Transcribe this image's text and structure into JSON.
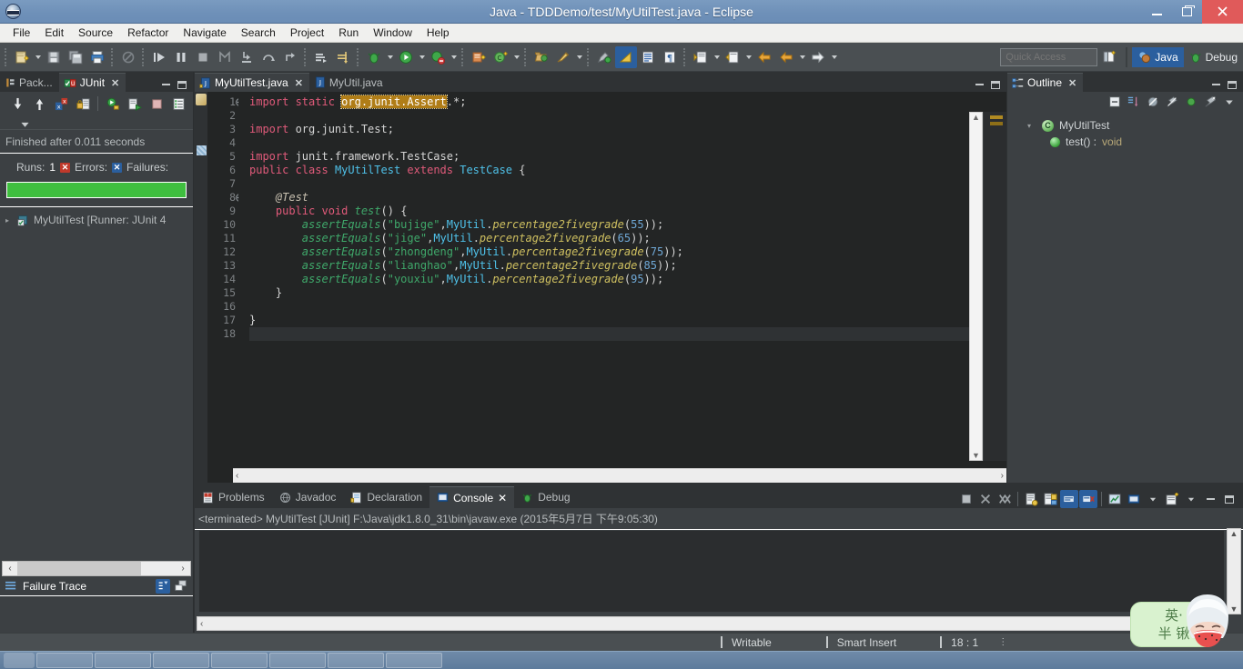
{
  "window": {
    "title": "Java - TDDDemo/test/MyUtilTest.java - Eclipse",
    "minimize_label": "–",
    "maximize_label": "❐",
    "close_label": "✕"
  },
  "menubar": {
    "items": [
      {
        "label": "File"
      },
      {
        "label": "Edit"
      },
      {
        "label": "Source"
      },
      {
        "label": "Refactor"
      },
      {
        "label": "Navigate"
      },
      {
        "label": "Search"
      },
      {
        "label": "Project"
      },
      {
        "label": "Run"
      },
      {
        "label": "Window"
      },
      {
        "label": "Help"
      }
    ]
  },
  "toolbar": {
    "quick_access_placeholder": "Quick Access",
    "perspectives": [
      {
        "label": "Java",
        "active": true
      },
      {
        "label": "Debug",
        "active": false
      }
    ],
    "icons": [
      "new-wizard-icon",
      "save-icon",
      "save-all-icon",
      "print-icon",
      "toggle-breakpoint-icon",
      "resume-icon",
      "suspend-icon",
      "terminate-icon",
      "disconnect-icon",
      "step-into-icon",
      "step-over-icon",
      "step-return-icon",
      "skip-breakpoints-icon",
      "use-step-filters-icon",
      "debug-icon",
      "run-icon",
      "run-external-tools-icon",
      "new-java-project-icon",
      "new-class-icon",
      "open-type-icon",
      "search-icon",
      "last-edit-location-icon",
      "toggle-mark-occurrences-icon",
      "show-whitespace-icon",
      "show-source-icon",
      "next-annotation-icon",
      "previous-annotation-icon",
      "back-icon",
      "forward-icon",
      "open-perspective-icon"
    ]
  },
  "junit_view": {
    "tabs": [
      {
        "label": "Pack...",
        "active": false,
        "icon": "package-explorer-icon"
      },
      {
        "label": "JUnit",
        "active": true,
        "icon": "junit-icon",
        "closable": true
      }
    ],
    "toolbar_icons": [
      "next-failure-icon",
      "previous-failure-icon",
      "show-failures-only-icon",
      "lock-scroll-icon",
      "rerun-test-icon",
      "rerun-failed-icon",
      "stop-icon",
      "test-run-history-icon",
      "view-menu-icon"
    ],
    "status_text": "Finished after 0.011 seconds",
    "counts": {
      "runs_label": "Runs:",
      "runs_value": "1",
      "errors_label": "Errors:",
      "errors_value": "",
      "failures_label": "Failures:",
      "failures_value": ""
    },
    "progress": {
      "percent": 100,
      "color": "#3fbf3f"
    },
    "tree": [
      {
        "label": "MyUtilTest [Runner: JUnit 4",
        "icon": "test-pass-icon"
      }
    ],
    "failure_trace_label": "Failure Trace",
    "failure_trace_icons": [
      "filter-stack-trace-icon",
      "copy-trace-icon"
    ],
    "min_label": "–",
    "max_label": "□"
  },
  "editor": {
    "tabs": [
      {
        "label": "MyUtilTest.java",
        "active": true,
        "closable": true,
        "icon": "java-test-file-icon"
      },
      {
        "label": "MyUtil.java",
        "active": false,
        "closable": false,
        "icon": "java-file-icon"
      }
    ],
    "min_label": "–",
    "max_label": "□",
    "cursor_line": 18,
    "lines": [
      {
        "n": 1,
        "fold": true,
        "tokens": [
          {
            "t": "import ",
            "c": "kw"
          },
          {
            "t": "static ",
            "c": "kw"
          },
          {
            "t": "org.junit.Assert",
            "c": "hl"
          },
          {
            "t": ".*;",
            "c": "pln"
          }
        ]
      },
      {
        "n": 2,
        "fold": false,
        "tokens": []
      },
      {
        "n": 3,
        "fold": false,
        "tokens": [
          {
            "t": "import ",
            "c": "kw"
          },
          {
            "t": "org.junit.Test;",
            "c": "pln"
          }
        ]
      },
      {
        "n": 4,
        "fold": false,
        "tokens": []
      },
      {
        "n": 5,
        "fold": false,
        "tokens": [
          {
            "t": "import ",
            "c": "kw"
          },
          {
            "t": "junit.framework.TestCase;",
            "c": "pln"
          }
        ]
      },
      {
        "n": 6,
        "fold": false,
        "tokens": [
          {
            "t": "public ",
            "c": "kw"
          },
          {
            "t": "class ",
            "c": "kw"
          },
          {
            "t": "MyUtilTest ",
            "c": "cls"
          },
          {
            "t": "extends ",
            "c": "kw"
          },
          {
            "t": "TestCase",
            "c": "cls"
          },
          {
            "t": " {",
            "c": "pln"
          }
        ]
      },
      {
        "n": 7,
        "fold": false,
        "tokens": []
      },
      {
        "n": 8,
        "fold": true,
        "tokens": [
          {
            "t": "    @Test",
            "c": "ann"
          }
        ]
      },
      {
        "n": 9,
        "fold": false,
        "tokens": [
          {
            "t": "    public ",
            "c": "kw"
          },
          {
            "t": "void ",
            "c": "kw"
          },
          {
            "t": "test",
            "c": "mth"
          },
          {
            "t": "() {",
            "c": "pln"
          }
        ]
      },
      {
        "n": 10,
        "fold": false,
        "tokens": [
          {
            "t": "        ",
            "c": "pln"
          },
          {
            "t": "assertEquals",
            "c": "mth"
          },
          {
            "t": "(",
            "c": "pln"
          },
          {
            "t": "\"bujige\"",
            "c": "str"
          },
          {
            "t": ",",
            "c": "pln"
          },
          {
            "t": "MyUtil",
            "c": "cls"
          },
          {
            "t": ".",
            "c": "pln"
          },
          {
            "t": "percentage2fivegrade",
            "c": "fld"
          },
          {
            "t": "(",
            "c": "pln"
          },
          {
            "t": "55",
            "c": "num"
          },
          {
            "t": "));",
            "c": "pln"
          }
        ]
      },
      {
        "n": 11,
        "fold": false,
        "tokens": [
          {
            "t": "        ",
            "c": "pln"
          },
          {
            "t": "assertEquals",
            "c": "mth"
          },
          {
            "t": "(",
            "c": "pln"
          },
          {
            "t": "\"jige\"",
            "c": "str"
          },
          {
            "t": ",",
            "c": "pln"
          },
          {
            "t": "MyUtil",
            "c": "cls"
          },
          {
            "t": ".",
            "c": "pln"
          },
          {
            "t": "percentage2fivegrade",
            "c": "fld"
          },
          {
            "t": "(",
            "c": "pln"
          },
          {
            "t": "65",
            "c": "num"
          },
          {
            "t": "));",
            "c": "pln"
          }
        ]
      },
      {
        "n": 12,
        "fold": false,
        "tokens": [
          {
            "t": "        ",
            "c": "pln"
          },
          {
            "t": "assertEquals",
            "c": "mth"
          },
          {
            "t": "(",
            "c": "pln"
          },
          {
            "t": "\"zhongdeng\"",
            "c": "str"
          },
          {
            "t": ",",
            "c": "pln"
          },
          {
            "t": "MyUtil",
            "c": "cls"
          },
          {
            "t": ".",
            "c": "pln"
          },
          {
            "t": "percentage2fivegrade",
            "c": "fld"
          },
          {
            "t": "(",
            "c": "pln"
          },
          {
            "t": "75",
            "c": "num"
          },
          {
            "t": "));",
            "c": "pln"
          }
        ]
      },
      {
        "n": 13,
        "fold": false,
        "tokens": [
          {
            "t": "        ",
            "c": "pln"
          },
          {
            "t": "assertEquals",
            "c": "mth"
          },
          {
            "t": "(",
            "c": "pln"
          },
          {
            "t": "\"lianghao\"",
            "c": "str"
          },
          {
            "t": ",",
            "c": "pln"
          },
          {
            "t": "MyUtil",
            "c": "cls"
          },
          {
            "t": ".",
            "c": "pln"
          },
          {
            "t": "percentage2fivegrade",
            "c": "fld"
          },
          {
            "t": "(",
            "c": "pln"
          },
          {
            "t": "85",
            "c": "num"
          },
          {
            "t": "));",
            "c": "pln"
          }
        ]
      },
      {
        "n": 14,
        "fold": false,
        "tokens": [
          {
            "t": "        ",
            "c": "pln"
          },
          {
            "t": "assertEquals",
            "c": "mth"
          },
          {
            "t": "(",
            "c": "pln"
          },
          {
            "t": "\"youxiu\"",
            "c": "str"
          },
          {
            "t": ",",
            "c": "pln"
          },
          {
            "t": "MyUtil",
            "c": "cls"
          },
          {
            "t": ".",
            "c": "pln"
          },
          {
            "t": "percentage2fivegrade",
            "c": "fld"
          },
          {
            "t": "(",
            "c": "pln"
          },
          {
            "t": "95",
            "c": "num"
          },
          {
            "t": "));",
            "c": "pln"
          }
        ]
      },
      {
        "n": 15,
        "fold": false,
        "tokens": [
          {
            "t": "    }",
            "c": "pln"
          }
        ]
      },
      {
        "n": 16,
        "fold": false,
        "tokens": []
      },
      {
        "n": 17,
        "fold": false,
        "tokens": [
          {
            "t": "}",
            "c": "pln"
          }
        ]
      },
      {
        "n": 18,
        "fold": false,
        "tokens": []
      }
    ]
  },
  "outline": {
    "tabs": [
      {
        "label": "Outline",
        "active": true,
        "closable": true,
        "icon": "outline-icon"
      }
    ],
    "toolbar_icons": [
      "collapse-all-icon",
      "sort-icon",
      "hide-fields-icon",
      "hide-static-icon",
      "hide-nonpublic-icon",
      "hide-local-types-icon",
      "view-menu-icon"
    ],
    "min_label": "–",
    "max_label": "□",
    "tree": [
      {
        "label": "MyUtilTest",
        "icon": "class-icon",
        "indent": 0
      },
      {
        "label": "test() : ",
        "type": "void",
        "icon": "public-method-icon",
        "indent": 1
      }
    ]
  },
  "console": {
    "tabs": [
      {
        "label": "Problems",
        "active": false,
        "icon": "problems-icon"
      },
      {
        "label": "Javadoc",
        "active": false,
        "icon": "javadoc-icon"
      },
      {
        "label": "Declaration",
        "active": false,
        "icon": "declaration-icon"
      },
      {
        "label": "Console",
        "active": true,
        "closable": true,
        "icon": "console-icon"
      },
      {
        "label": "Debug",
        "active": false,
        "icon": "debug-icon"
      }
    ],
    "toolbar_icons": [
      "terminate-icon",
      "remove-launch-icon",
      "remove-all-terminated-icon",
      "show-console-on-output-icon",
      "pin-console-icon",
      "scroll-lock-icon",
      "clear-console-icon",
      "display-selected-console-icon",
      "open-console-icon",
      "new-console-view-icon",
      "minimize-icon",
      "maximize-icon"
    ],
    "output_header": "<terminated> MyUtilTest [JUnit] F:\\Java\\jdk1.8.0_31\\bin\\javaw.exe (2015年5月7日 下午9:05:30)",
    "body_text": "",
    "min_label": "–",
    "max_label": "□"
  },
  "statusbar": {
    "writable": "Writable",
    "insert_mode": "Smart Insert",
    "position": "18 : 1"
  },
  "ime": {
    "line1": "英",
    "line2": "半 锹",
    "dot": "·"
  },
  "colors": {
    "title_bar": "#6e90b8",
    "toolbar": "#4a4f52",
    "panel_bg": "#3c4043",
    "editor_bg": "#232525",
    "accent_blue": "#2b5f9e",
    "progress_green": "#3fbf3f",
    "close_red": "#e05a5a",
    "highlight_gold": "#b07d17"
  }
}
